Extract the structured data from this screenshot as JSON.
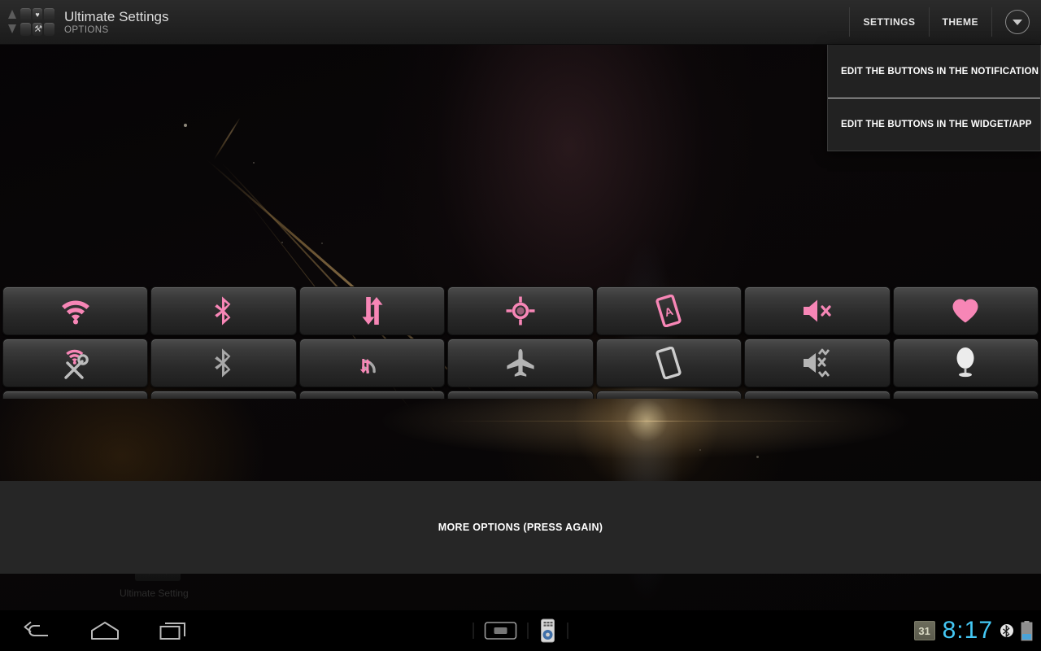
{
  "app": {
    "title": "Ultimate Settings",
    "subtitle": "OPTIONS",
    "icon_name": "ultimate-settings-app-icon"
  },
  "action_bar": {
    "settings_label": "SETTINGS",
    "theme_label": "THEME",
    "overflow_icon": "chevron-down-circle-icon"
  },
  "dropdown": {
    "items": [
      {
        "label": "EDIT THE BUTTONS IN THE NOTIFICATION",
        "name": "menu-item-edit-notification-buttons"
      },
      {
        "label": "EDIT THE BUTTONS IN THE WIDGET/APP",
        "name": "menu-item-edit-widget-app-buttons"
      }
    ]
  },
  "toggles": {
    "row1": [
      {
        "name": "toggle-wifi",
        "icon": "wifi-icon",
        "state": "on",
        "color": "#f786b6"
      },
      {
        "name": "toggle-bluetooth",
        "icon": "bluetooth-icon",
        "state": "on",
        "color": "#f786b6"
      },
      {
        "name": "toggle-data-sync",
        "icon": "data-sync-arrows-icon",
        "state": "on",
        "color": "#f786b6"
      },
      {
        "name": "toggle-gps-location",
        "icon": "gps-crosshair-icon",
        "state": "on",
        "color": "#f786b6"
      },
      {
        "name": "toggle-auto-rotate",
        "icon": "auto-rotate-screen-icon",
        "state": "on",
        "color": "#f786b6"
      },
      {
        "name": "toggle-sound-mute",
        "icon": "speaker-mute-icon",
        "state": "on",
        "color": "#f786b6"
      },
      {
        "name": "toggle-favorite",
        "icon": "heart-icon",
        "state": "on",
        "color": "#f786b6"
      }
    ],
    "row2": [
      {
        "name": "toggle-wifi-settings",
        "icon": "wifi-tools-icon",
        "state": "off",
        "color": "#a8a8a8"
      },
      {
        "name": "toggle-bluetooth-settings",
        "icon": "bluetooth-off-icon",
        "state": "off",
        "color": "#a8a8a8"
      },
      {
        "name": "toggle-hotspot-tethering",
        "icon": "hotspot-arrows-icon",
        "state": "off",
        "color": "#a8a8a8"
      },
      {
        "name": "toggle-airplane-mode",
        "icon": "airplane-icon",
        "state": "off",
        "color": "#a8a8a8"
      },
      {
        "name": "toggle-rotation-lock",
        "icon": "screen-rotation-lock-icon",
        "state": "off",
        "color": "#a8a8a8"
      },
      {
        "name": "toggle-vibrate-silent",
        "icon": "vibrate-mute-icon",
        "state": "off",
        "color": "#a8a8a8"
      },
      {
        "name": "toggle-brightness",
        "icon": "lamp-brightness-icon",
        "state": "off",
        "color": "#e8e8e8"
      }
    ],
    "row3_clipped": [
      {
        "name": "toggle-row3-slot-1"
      },
      {
        "name": "toggle-row3-slot-2"
      },
      {
        "name": "toggle-row3-slot-3"
      },
      {
        "name": "toggle-row3-slot-4"
      },
      {
        "name": "toggle-row3-slot-5"
      },
      {
        "name": "toggle-row3-slot-6"
      },
      {
        "name": "toggle-row3-slot-7"
      }
    ]
  },
  "more_options": {
    "label": "MORE OPTIONS (PRESS AGAIN)"
  },
  "homescreen": {
    "ghost_label": "Ultimate Setting"
  },
  "system_bar": {
    "back_icon": "back-arrow-icon",
    "home_icon": "home-icon",
    "recents_icon": "recent-apps-icon",
    "ime_keyboard_icon": "keyboard-icon",
    "ime_remote_icon": "remote-control-icon",
    "calendar_day": "31",
    "clock": "8:17",
    "bluetooth_icon": "bluetooth-status-icon",
    "battery_icon": "battery-icon"
  },
  "colors": {
    "accent_pink": "#f786b6",
    "clock_cyan": "#44c8f5",
    "bar_background": "#232323",
    "panel_background": "#262626"
  }
}
